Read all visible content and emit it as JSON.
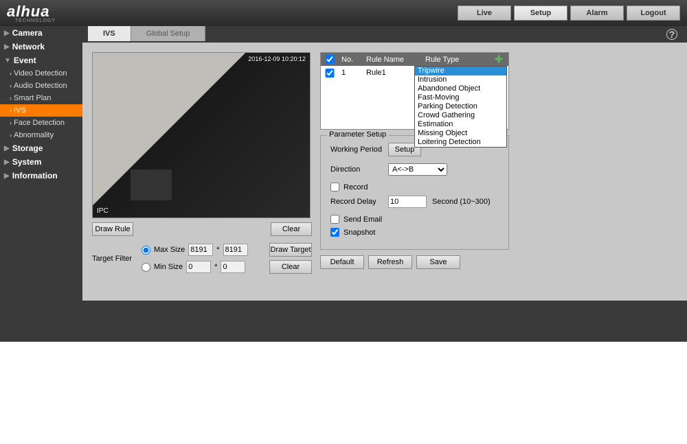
{
  "brand": "alhua",
  "brand_sub": "TECHNOLOGY",
  "topnav": {
    "live": "Live",
    "setup": "Setup",
    "alarm": "Alarm",
    "logout": "Logout"
  },
  "sidebar": {
    "camera": "Camera",
    "network": "Network",
    "event": "Event",
    "video_detection": "Video Detection",
    "audio_detection": "Audio Detection",
    "smart_plan": "Smart Plan",
    "ivs": "IVS",
    "face_detection": "Face Detection",
    "abnormality": "Abnormality",
    "storage": "Storage",
    "system": "System",
    "information": "Information"
  },
  "tabs": {
    "ivs": "IVS",
    "global": "Global Setup"
  },
  "video": {
    "timestamp": "2016-12-09 10:20:12",
    "label": "IPC"
  },
  "buttons": {
    "draw_rule": "Draw Rule",
    "clear": "Clear",
    "draw_target": "Draw Target",
    "default": "Default",
    "refresh": "Refresh",
    "save": "Save",
    "setup": "Setup"
  },
  "filter": {
    "label": "Target Filter",
    "max": "Max Size",
    "min": "Min Size",
    "max_w": "8191",
    "max_h": "8191",
    "min_w": "0",
    "min_h": "0",
    "sep": "*"
  },
  "rules": {
    "head_no": "No.",
    "head_name": "Rule Name",
    "head_type": "Rule Type",
    "row_no": "1",
    "row_name": "Rule1"
  },
  "dropdown": {
    "tripwire": "Tripwire",
    "intrusion": "Intrusion",
    "abandoned": "Abandoned Object",
    "fast": "Fast-Moving",
    "parking": "Parking Detection",
    "crowd": "Crowd Gathering Estimation",
    "missing": "Missing Object",
    "loitering": "Loitering Detection"
  },
  "params": {
    "title": "Parameter Setup",
    "working_period": "Working Period",
    "direction": "Direction",
    "direction_val": "A<->B",
    "record": "Record",
    "record_delay": "Record Delay",
    "record_delay_val": "10",
    "record_delay_unit": "Second (10~300)",
    "send_email": "Send Email",
    "snapshot": "Snapshot"
  }
}
